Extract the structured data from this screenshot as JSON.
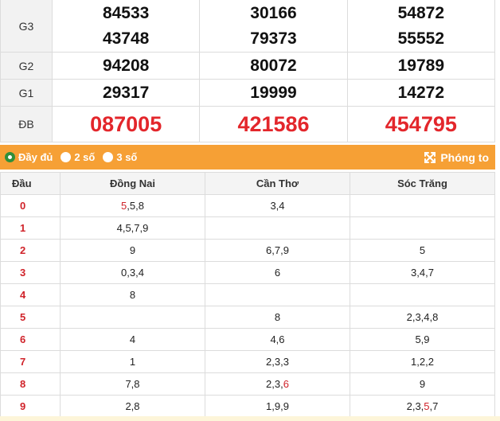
{
  "results": {
    "rows": [
      {
        "label": "G3",
        "cells": [
          [
            "84533",
            "43748"
          ],
          [
            "30166",
            "79373"
          ],
          [
            "54872",
            "55552"
          ]
        ]
      },
      {
        "label": "G2",
        "cells": [
          [
            "94208"
          ],
          [
            "80072"
          ],
          [
            "19789"
          ]
        ]
      },
      {
        "label": "G1",
        "cells": [
          [
            "29317"
          ],
          [
            "19999"
          ],
          [
            "14272"
          ]
        ]
      },
      {
        "label": "ĐB",
        "cells": [
          [
            "087005"
          ],
          [
            "421586"
          ],
          [
            "454795"
          ]
        ]
      }
    ]
  },
  "toolbar": {
    "option_full": "Đầy đủ",
    "option_2": "2 số",
    "option_3": "3 số",
    "zoom_label": "Phóng to"
  },
  "loto": {
    "headers": [
      "Đầu",
      "Đồng Nai",
      "Cần Thơ",
      "Sóc Trăng"
    ],
    "rows": [
      {
        "dau": "0",
        "c1": [
          {
            "t": "5",
            "hl": true
          },
          {
            "t": ",5,8"
          }
        ],
        "c2": [
          {
            "t": "3,4"
          }
        ],
        "c3": [
          {
            "t": ""
          }
        ]
      },
      {
        "dau": "1",
        "c1": [
          {
            "t": "4,5,7,9"
          }
        ],
        "c2": [
          {
            "t": ""
          }
        ],
        "c3": [
          {
            "t": ""
          }
        ]
      },
      {
        "dau": "2",
        "c1": [
          {
            "t": "9"
          }
        ],
        "c2": [
          {
            "t": "6,7,9"
          }
        ],
        "c3": [
          {
            "t": "5"
          }
        ]
      },
      {
        "dau": "3",
        "c1": [
          {
            "t": "0,3,4"
          }
        ],
        "c2": [
          {
            "t": "6"
          }
        ],
        "c3": [
          {
            "t": "3,4,7"
          }
        ]
      },
      {
        "dau": "4",
        "c1": [
          {
            "t": "8"
          }
        ],
        "c2": [
          {
            "t": ""
          }
        ],
        "c3": [
          {
            "t": ""
          }
        ]
      },
      {
        "dau": "5",
        "c1": [
          {
            "t": ""
          }
        ],
        "c2": [
          {
            "t": "8"
          }
        ],
        "c3": [
          {
            "t": "2,3,4,8"
          }
        ]
      },
      {
        "dau": "6",
        "c1": [
          {
            "t": "4"
          }
        ],
        "c2": [
          {
            "t": "4,6"
          }
        ],
        "c3": [
          {
            "t": "5,9"
          }
        ]
      },
      {
        "dau": "7",
        "c1": [
          {
            "t": "1"
          }
        ],
        "c2": [
          {
            "t": "2,3,3"
          }
        ],
        "c3": [
          {
            "t": "1,2,2"
          }
        ]
      },
      {
        "dau": "8",
        "c1": [
          {
            "t": "7,8"
          }
        ],
        "c2": [
          {
            "t": "2,3,"
          },
          {
            "t": "6",
            "hl": true
          }
        ],
        "c3": [
          {
            "t": "9"
          }
        ]
      },
      {
        "dau": "9",
        "c1": [
          {
            "t": "2,8"
          }
        ],
        "c2": [
          {
            "t": "1,9,9"
          }
        ],
        "c3": [
          {
            "t": "2,3,"
          },
          {
            "t": "5",
            "hl": true
          },
          {
            "t": ",7"
          }
        ]
      }
    ]
  },
  "colors": {
    "accent_orange": "#f6a035",
    "special_red": "#e3262b",
    "selected_green": "#2f8f3a"
  }
}
